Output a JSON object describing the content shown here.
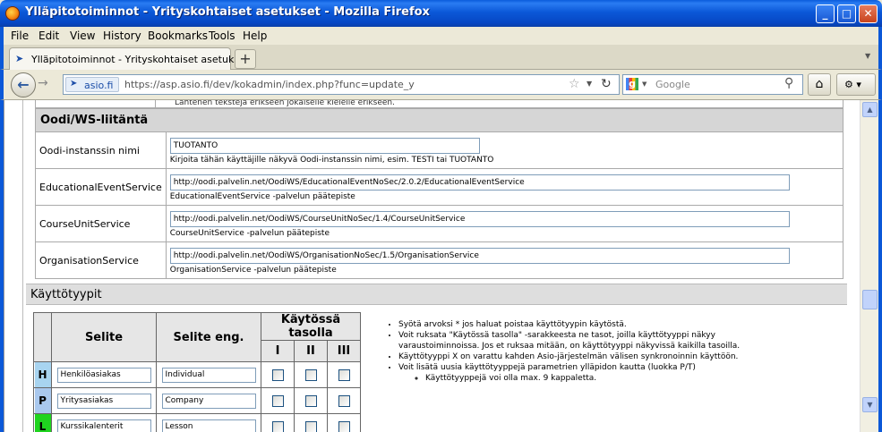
{
  "window": {
    "title": "Ylläpitotoiminnot - Yrityskohtaiset asetukset - Mozilla Firefox"
  },
  "menu": [
    "File",
    "Edit",
    "View",
    "History",
    "Bookmarks",
    "Tools",
    "Help"
  ],
  "tab": {
    "label": "Ylläpitotoiminnot - Yrityskohtaiset asetukset",
    "new_tab": "+"
  },
  "nav": {
    "site": "asio.fi",
    "url": "https://asp.asio.fi/dev/kokadmin/index.php?func=update_y",
    "search_placeholder": "Google"
  },
  "page": {
    "cut_text": "Lähtenen tekstejä erikseen jokaiselle kielelle erikseen.",
    "oodi_section": {
      "title": "Oodi/WS-liitäntä",
      "rows": [
        {
          "label": "Oodi-instanssin nimi",
          "value": "TUOTANTO",
          "hint": "Kirjoita tähän käyttäjille näkyvä Oodi-instanssin nimi, esim. TESTI tai TUOTANTO"
        },
        {
          "label": "EducationalEventService",
          "value": "http://oodi.palvelin.net/OodiWS/EducationalEventNoSec/2.0.2/EducationalEventService",
          "hint": "EducationalEventService -palvelun päätepiste"
        },
        {
          "label": "CourseUnitService",
          "value": "http://oodi.palvelin.net/OodiWS/CourseUnitNoSec/1.4/CourseUnitService",
          "hint": "CourseUnitService -palvelun päätepiste"
        },
        {
          "label": "OrganisationService",
          "value": "http://oodi.palvelin.net/OodiWS/OrganisationNoSec/1.5/OrganisationService",
          "hint": "OrganisationService -palvelun päätepiste"
        }
      ]
    },
    "types_section": {
      "title": "Käyttötyypit",
      "headers": {
        "selite": "Selite",
        "selite_eng": "Selite eng.",
        "levels": "Käytössä tasolla",
        "l1": "I",
        "l2": "II",
        "l3": "III"
      },
      "rows": [
        {
          "letter": "H",
          "color": "#a8d4f0",
          "selite": "Henkilöasiakas",
          "eng": "Individual"
        },
        {
          "letter": "P",
          "color": "#a9c8ee",
          "selite": "Yritysasiakas",
          "eng": "Company"
        },
        {
          "letter": "L",
          "color": "#1fd41f",
          "selite": "Kurssikalenterit",
          "eng": "Lesson"
        }
      ],
      "notes": [
        "Syötä arvoksi * jos haluat poistaa käyttötyypin käytöstä.",
        "Voit ruksata \"Käytössä tasolla\" -sarakkeesta ne tasot, joilla käyttötyyppi näkyy varaustoiminnoissa. Jos et ruksaa mitään, on käyttötyyppi näkyvissä kaikilla tasoilla.",
        "Käyttötyyppi X on varattu kahden Asio-järjestelmän välisen synkronoinnin käyttöön.",
        "Voit lisätä uusia käyttötyyppejä parametrien ylläpidon kautta (luokka P/T)"
      ],
      "subnote": "Käyttötyyppejä voi olla max. 9 kappaletta."
    }
  }
}
